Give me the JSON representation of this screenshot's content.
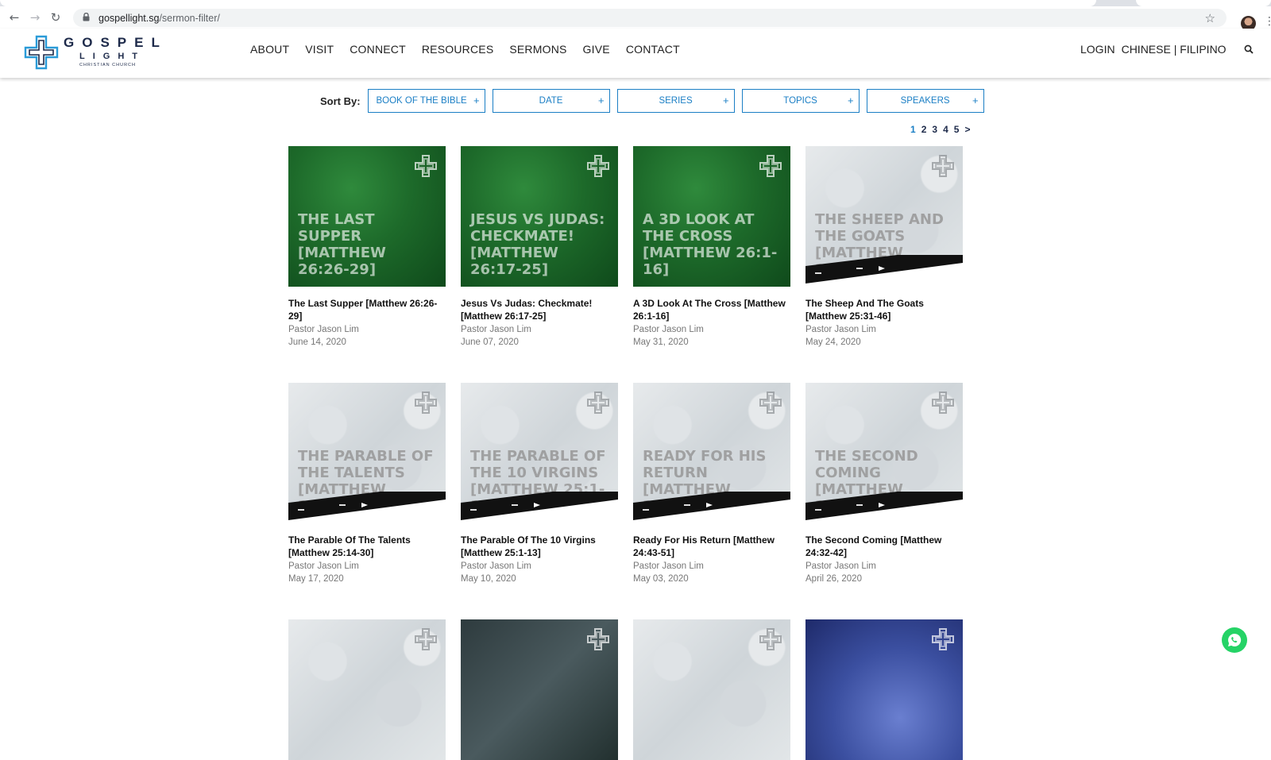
{
  "browser": {
    "url_domain": "gospellight.sg",
    "url_path": "/sermon-filter/"
  },
  "logo": {
    "line1": "GOSPEL",
    "line2": "LIGHT",
    "line3": "CHRISTIAN CHURCH"
  },
  "nav": {
    "items": [
      "ABOUT",
      "VISIT",
      "CONNECT",
      "RESOURCES",
      "SERMONS",
      "GIVE",
      "CONTACT"
    ],
    "login": "LOGIN",
    "languages": "CHINESE | FILIPINO"
  },
  "sort": {
    "label": "Sort By:",
    "filters": [
      "BOOK OF THE BIBLE",
      "DATE",
      "SERIES",
      "TOPICS",
      "SPEAKERS"
    ],
    "plus": "+"
  },
  "pagination": {
    "pages": [
      "1",
      "2",
      "3",
      "4",
      "5"
    ],
    "next": ">",
    "current": "1"
  },
  "sermons": [
    {
      "thumb_title": "THE LAST SUPPER [MATTHEW 26:26-29]",
      "title": "The Last Supper [Matthew 26:26-29]",
      "speaker": "Pastor Jason Lim",
      "date": "June 14, 2020",
      "style": "green"
    },
    {
      "thumb_title": "JESUS VS JUDAS: CHECKMATE! [MATTHEW 26:17-25]",
      "title": "Jesus Vs Judas: Checkmate! [Matthew 26:17-25]",
      "speaker": "Pastor Jason Lim",
      "date": "June 07, 2020",
      "style": "green"
    },
    {
      "thumb_title": "A 3D LOOK AT THE CROSS [MATTHEW 26:1-16]",
      "title": "A 3D Look At The Cross [Matthew 26:1-16]",
      "speaker": "Pastor Jason Lim",
      "date": "May 31, 2020",
      "style": "green"
    },
    {
      "thumb_title": "THE SHEEP AND THE GOATS [MATTHEW 25:31-46]",
      "title": "The Sheep And The Goats [Matthew 25:31-46]",
      "speaker": "Pastor Jason Lim",
      "date": "May 24, 2020",
      "style": "stone"
    },
    {
      "thumb_title": "THE PARABLE OF THE TALENTS [MATTHEW 25:14-30]",
      "title": "The Parable Of The Talents [Matthew 25:14-30]",
      "speaker": "Pastor Jason Lim",
      "date": "May 17, 2020",
      "style": "stone"
    },
    {
      "thumb_title": "THE PARABLE OF THE 10 VIRGINS [MATTHEW 25:1-13]",
      "title": "The Parable Of The 10 Virgins [Matthew 25:1-13]",
      "speaker": "Pastor Jason Lim",
      "date": "May 10, 2020",
      "style": "stone"
    },
    {
      "thumb_title": "READY FOR HIS RETURN [MATTHEW 24:43-51]",
      "title": "Ready For His Return [Matthew 24:43-51]",
      "speaker": "Pastor Jason Lim",
      "date": "May 03, 2020",
      "style": "stone"
    },
    {
      "thumb_title": "THE SECOND COMING [MATTHEW 24:32-42]",
      "title": "The Second Coming [Matthew 24:32-42]",
      "speaker": "Pastor Jason Lim",
      "date": "April 26, 2020",
      "style": "stone"
    },
    {
      "style": "stone"
    },
    {
      "style": "dark"
    },
    {
      "style": "stone"
    },
    {
      "style": "blue"
    }
  ],
  "colors": {
    "accent": "#1b7fc5",
    "brand_navy": "#1d2a4a",
    "whatsapp": "#25d366"
  }
}
